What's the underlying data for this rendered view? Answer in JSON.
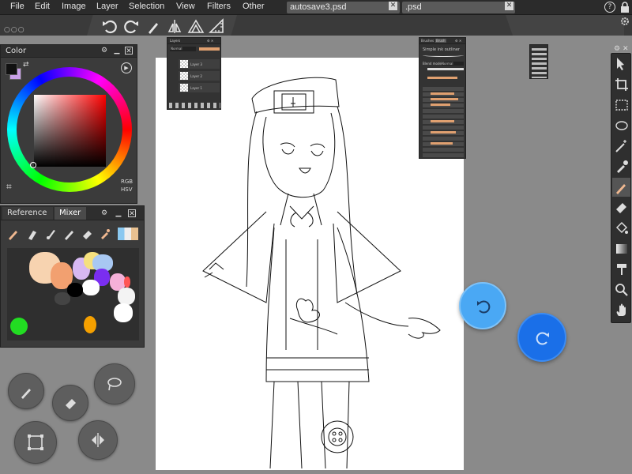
{
  "menu": [
    "File",
    "Edit",
    "Image",
    "Layer",
    "Selection",
    "View",
    "Filters",
    "Other"
  ],
  "tabs": [
    {
      "label": "autosave3.psd",
      "close": "✕"
    },
    {
      "label": ".psd",
      "close": "✕"
    }
  ],
  "help_icon": "?",
  "color_panel": {
    "title": "Color",
    "modes": [
      "RGB",
      "HSV"
    ]
  },
  "mixer_panel": {
    "tabs": [
      "Reference",
      "Mixer"
    ],
    "active_tab": "Mixer"
  },
  "layers_panel": {
    "title": "Layers",
    "blend": "Normal",
    "layers": [
      "Layer 3",
      "Layer 2",
      "Layer 1"
    ]
  },
  "brush_panel": {
    "tabs": [
      "Brushes",
      "Brush"
    ],
    "name": "Simple ink outliner",
    "blend_label": "Blend mode",
    "blend": "Normal"
  },
  "colors": {
    "accent": "#2b8cf0",
    "menubar": "#2b2b2b",
    "panel": "#3b3b3b",
    "foreground": "#111111",
    "background": "#c9a0e8"
  }
}
